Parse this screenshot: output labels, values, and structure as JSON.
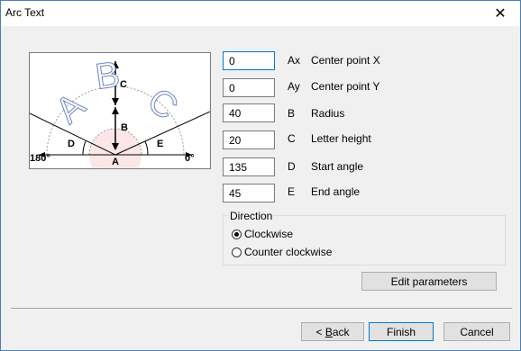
{
  "window": {
    "title": "Arc Text"
  },
  "figure": {
    "letters": [
      "A",
      "B",
      "C"
    ],
    "labels": {
      "c": "C",
      "b": "B",
      "d": "D",
      "e": "E",
      "a": "A",
      "left": "180°",
      "right": "0°"
    }
  },
  "fields": [
    {
      "value": "0",
      "symbol": "Ax",
      "label": "Center point X"
    },
    {
      "value": "0",
      "symbol": "Ay",
      "label": "Center point Y"
    },
    {
      "value": "40",
      "symbol": "B",
      "label": "Radius"
    },
    {
      "value": "20",
      "symbol": "C",
      "label": "Letter height"
    },
    {
      "value": "135",
      "symbol": "D",
      "label": "Start angle"
    },
    {
      "value": "45",
      "symbol": "E",
      "label": "End angle"
    }
  ],
  "direction": {
    "title": "Direction",
    "options": [
      {
        "label": "Clockwise",
        "checked": true
      },
      {
        "label": "Counter clockwise",
        "checked": false
      }
    ]
  },
  "buttons": {
    "edit_parameters": "Edit parameters",
    "back_prefix": "< ",
    "back_key": "B",
    "back_rest": "ack",
    "finish": "Finish",
    "cancel": "Cancel"
  }
}
